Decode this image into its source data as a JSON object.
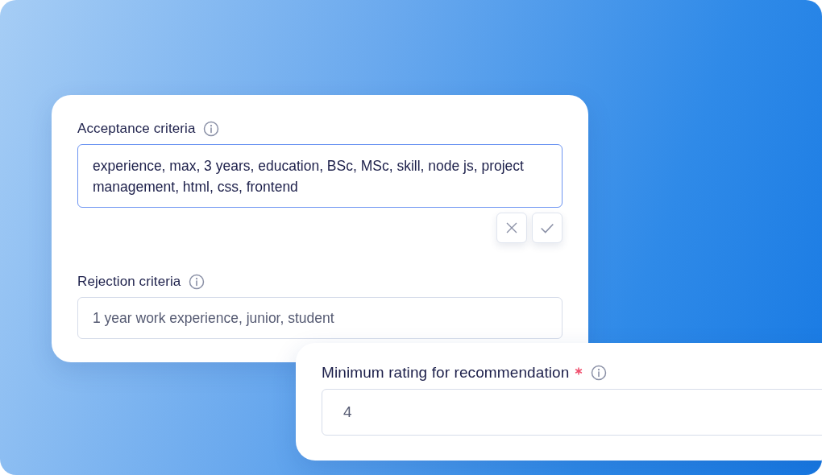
{
  "acceptance": {
    "label": "Acceptance criteria",
    "value": "experience, max, 3 years, education, BSc, MSc, skill, node js, project management, html, css, frontend",
    "focused": true,
    "actions": [
      {
        "kind": "cancel"
      },
      {
        "kind": "confirm"
      }
    ]
  },
  "rejection": {
    "label": "Rejection criteria",
    "value": "1 year work experience, junior, student",
    "focused": false
  },
  "rating": {
    "label": "Minimum rating for recommendation",
    "required": true,
    "value": "4",
    "focused": false
  }
}
